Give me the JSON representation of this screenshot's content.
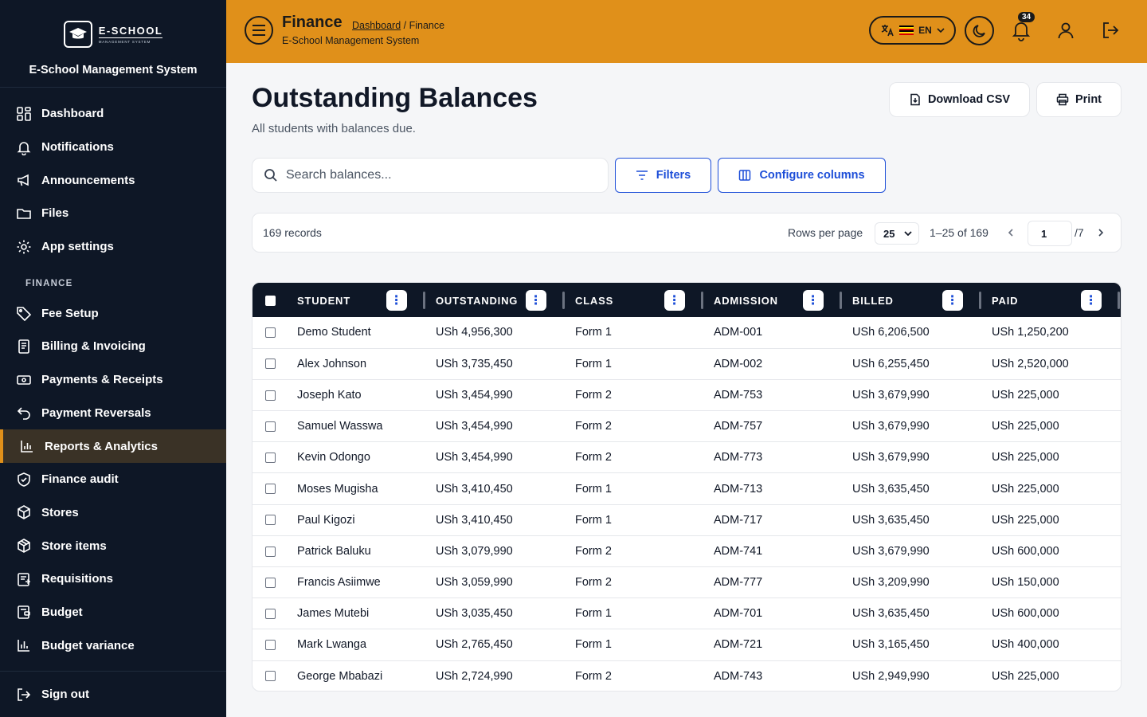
{
  "brand": {
    "logo_name": "E-SCHOOL",
    "logo_sub": "MANAGEMENT SYSTEM",
    "title": "E-School Management System"
  },
  "sidebar": {
    "items": [
      {
        "label": "Dashboard",
        "icon": "grid-icon"
      },
      {
        "label": "Notifications",
        "icon": "bell-icon"
      },
      {
        "label": "Announcements",
        "icon": "megaphone-icon"
      },
      {
        "label": "Files",
        "icon": "folder-icon"
      },
      {
        "label": "App settings",
        "icon": "gear-icon"
      }
    ],
    "section": "FINANCE",
    "finance_items": [
      {
        "label": "Fee Setup",
        "icon": "tag-icon"
      },
      {
        "label": "Billing & Invoicing",
        "icon": "invoice-icon"
      },
      {
        "label": "Payments & Receipts",
        "icon": "cash-icon"
      },
      {
        "label": "Payment Reversals",
        "icon": "undo-icon"
      },
      {
        "label": "Reports & Analytics",
        "icon": "bar-chart-icon",
        "active": true
      },
      {
        "label": "Finance audit",
        "icon": "shield-icon"
      },
      {
        "label": "Stores",
        "icon": "box-icon"
      },
      {
        "label": "Store items",
        "icon": "package-icon"
      },
      {
        "label": "Requisitions",
        "icon": "clipboard-icon"
      },
      {
        "label": "Budget",
        "icon": "wallet-icon"
      },
      {
        "label": "Budget variance",
        "icon": "chart-icon"
      }
    ],
    "signout": "Sign out"
  },
  "header": {
    "title": "Finance",
    "breadcrumb_link": "Dashboard",
    "breadcrumb_sep": " / ",
    "breadcrumb_current": "Finance",
    "subtitle": "E-School Management System",
    "lang": "EN",
    "notification_count": "34"
  },
  "page": {
    "title": "Outstanding Balances",
    "subtitle": "All students with balances due.",
    "download_csv": "Download CSV",
    "print": "Print",
    "search_placeholder": "Search balances...",
    "filters": "Filters",
    "configure_columns": "Configure columns"
  },
  "pager": {
    "records": "169 records",
    "rows_per_page_label": "Rows per page",
    "rows_per_page": "25",
    "range": "1–25 of 169",
    "page": "1",
    "total_pages": "/7"
  },
  "table": {
    "columns": [
      "STUDENT",
      "OUTSTANDING",
      "CLASS",
      "ADMISSION",
      "BILLED",
      "PAID"
    ],
    "rows": [
      [
        "Demo Student",
        "USh 4,956,300",
        "Form 1",
        "ADM-001",
        "USh 6,206,500",
        "USh 1,250,200"
      ],
      [
        "Alex Johnson",
        "USh 3,735,450",
        "Form 1",
        "ADM-002",
        "USh 6,255,450",
        "USh 2,520,000"
      ],
      [
        "Joseph Kato",
        "USh 3,454,990",
        "Form 2",
        "ADM-753",
        "USh 3,679,990",
        "USh 225,000"
      ],
      [
        "Samuel Wasswa",
        "USh 3,454,990",
        "Form 2",
        "ADM-757",
        "USh 3,679,990",
        "USh 225,000"
      ],
      [
        "Kevin Odongo",
        "USh 3,454,990",
        "Form 2",
        "ADM-773",
        "USh 3,679,990",
        "USh 225,000"
      ],
      [
        "Moses Mugisha",
        "USh 3,410,450",
        "Form 1",
        "ADM-713",
        "USh 3,635,450",
        "USh 225,000"
      ],
      [
        "Paul Kigozi",
        "USh 3,410,450",
        "Form 1",
        "ADM-717",
        "USh 3,635,450",
        "USh 225,000"
      ],
      [
        "Patrick Baluku",
        "USh 3,079,990",
        "Form 2",
        "ADM-741",
        "USh 3,679,990",
        "USh 600,000"
      ],
      [
        "Francis Asiimwe",
        "USh 3,059,990",
        "Form 2",
        "ADM-777",
        "USh 3,209,990",
        "USh 150,000"
      ],
      [
        "James Mutebi",
        "USh 3,035,450",
        "Form 1",
        "ADM-701",
        "USh 3,635,450",
        "USh 600,000"
      ],
      [
        "Mark Lwanga",
        "USh 2,765,450",
        "Form 1",
        "ADM-721",
        "USh 3,165,450",
        "USh 400,000"
      ],
      [
        "George Mbabazi",
        "USh 2,724,990",
        "Form 2",
        "ADM-743",
        "USh 2,949,990",
        "USh 225,000"
      ]
    ]
  },
  "colors": {
    "sidebar_bg": "#0e1726",
    "header_bg": "#e0901a",
    "accent_blue": "#1d4ed8",
    "active_bg": "#3a3226"
  }
}
